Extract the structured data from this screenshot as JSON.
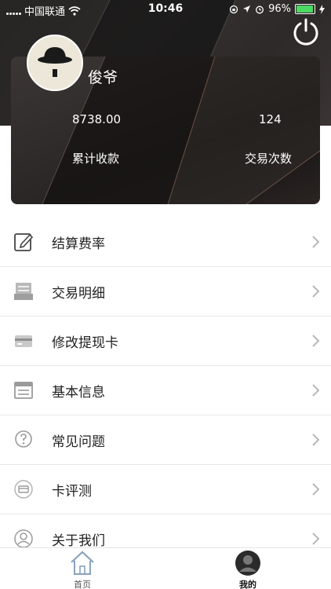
{
  "status_bar": {
    "carrier": "中国联通",
    "time": "10:46",
    "battery": "96%"
  },
  "profile": {
    "username": "俊爷",
    "stats": [
      {
        "value": "8738.00",
        "label": "累计收款"
      },
      {
        "value": "124",
        "label": "交易次数"
      }
    ]
  },
  "menu": {
    "items": [
      {
        "label": "结算费率",
        "icon": "edit-icon"
      },
      {
        "label": "交易明细",
        "icon": "receipt-icon"
      },
      {
        "label": "修改提现卡",
        "icon": "card-icon"
      },
      {
        "label": "基本信息",
        "icon": "document-icon"
      },
      {
        "label": "常见问题",
        "icon": "question-icon"
      },
      {
        "label": "卡评测",
        "icon": "card-check-icon"
      },
      {
        "label": "关于我们",
        "icon": "user-circle-icon"
      }
    ]
  },
  "tabbar": {
    "home_label": "首页",
    "me_label": "我的"
  },
  "colors": {
    "accent": "#4cd964",
    "text": "#222222",
    "divider": "#e7e7e7"
  }
}
